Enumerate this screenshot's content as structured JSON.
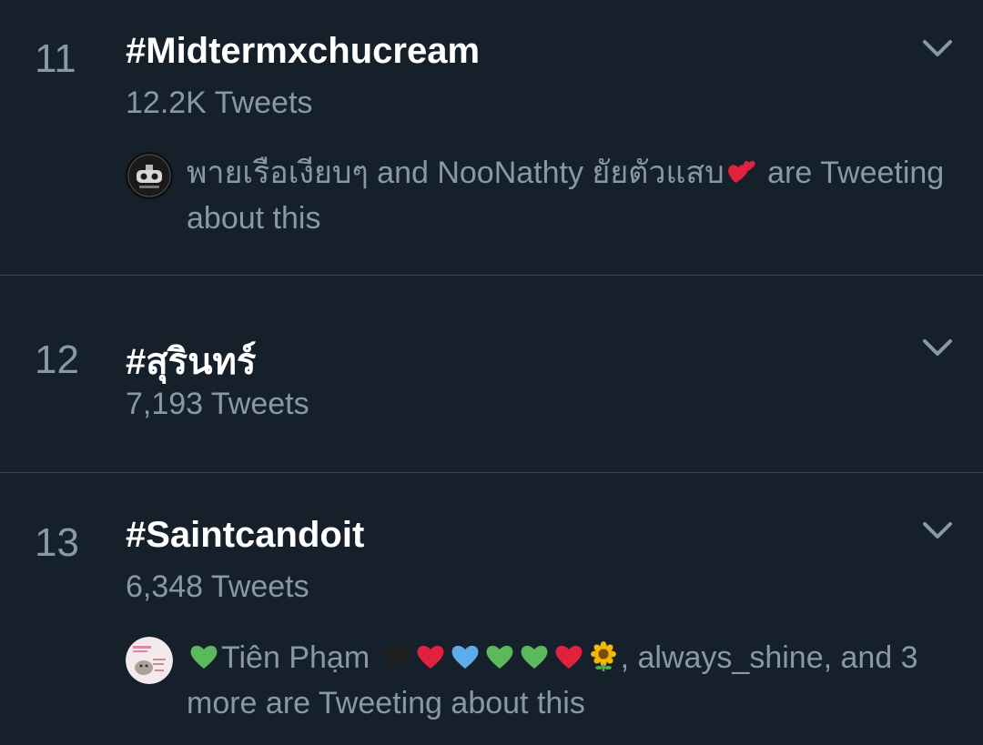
{
  "trends": [
    {
      "rank": "11",
      "tag": "#Midtermxchucream",
      "count": "12.2K Tweets",
      "context": {
        "name1": "พายเรือเงียบๆ",
        "joiner": " and ",
        "name2": "NooNathty ยัยตัวแสบ",
        "suffix": " are Tweeting about this"
      }
    },
    {
      "rank": "12",
      "tag": "#สุรินทร์",
      "count": "7,193 Tweets"
    },
    {
      "rank": "13",
      "tag": "#Saintcandoit",
      "count": "6,348 Tweets",
      "context": {
        "name1": "Tiên Phạm",
        "suffix": ", always_shine, and 3 more are Tweeting about this"
      }
    }
  ],
  "icons": {
    "chevron": "chevron-down-icon",
    "avatar1": "boat-avatar",
    "avatar2": "cartoon-avatar"
  },
  "colors": {
    "background": "#15202b",
    "primary_text": "#ffffff",
    "secondary_text": "#8899a6",
    "divider": "#38444d",
    "heart_green": "#5cb85c",
    "heart_red": "#e0223f",
    "heart_blue": "#5dadec",
    "heart_black": "#1d1f21"
  }
}
